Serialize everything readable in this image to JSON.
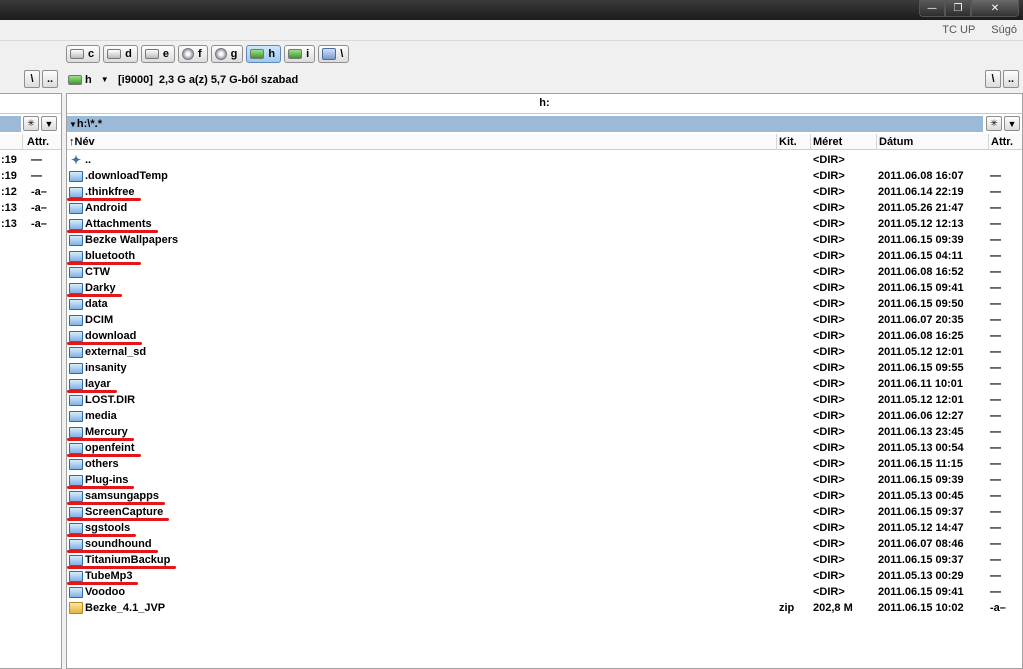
{
  "window": {
    "min_label": "—",
    "restore_label": "❐",
    "close_label": "✕"
  },
  "menu": {
    "right_items": [
      "TC UP",
      "Súgó"
    ]
  },
  "drives": [
    {
      "letter": "c",
      "icon": "hdd-icon"
    },
    {
      "letter": "d",
      "icon": "hdd-icon"
    },
    {
      "letter": "e",
      "icon": "hdd-icon"
    },
    {
      "letter": "f",
      "icon": "cd-icon"
    },
    {
      "letter": "g",
      "icon": "cd-icon"
    },
    {
      "letter": "h",
      "icon": "usb-drive-icon",
      "active": true
    },
    {
      "letter": "i",
      "icon": "usb-drive-icon"
    },
    {
      "letter": "\\",
      "icon": "network-icon"
    }
  ],
  "path_buttons": {
    "root": "\\",
    "up": ".."
  },
  "drive_info": {
    "drive": "h",
    "label": "[i9000]",
    "free": "2,3 G a(z) 5,7 G-ból szabad"
  },
  "left_panel": {
    "header_attr": "Attr.",
    "rows": [
      {
        "time": ":19",
        "attr": "—"
      },
      {
        "time": ":19",
        "attr": "—"
      },
      {
        "time": ":12",
        "attr": "-a–"
      },
      {
        "time": ":13",
        "attr": "-a–"
      },
      {
        "time": ":13",
        "attr": "-a–"
      }
    ]
  },
  "right_panel": {
    "current_dir": "h:",
    "path": "h:\\*.*",
    "columns": {
      "name": "Név",
      "ext": "Kit.",
      "size": "Méret",
      "date": "Dátum",
      "attr": "Attr."
    },
    "sort_indicator": "↑",
    "rows": [
      {
        "name": "..",
        "ext": "",
        "size": "<DIR>",
        "date": "",
        "attr": "",
        "icon": "up-dir-icon",
        "underline": 0
      },
      {
        "name": ".downloadTemp",
        "ext": "",
        "size": "<DIR>",
        "date": "2011.06.08 16:07",
        "attr": "—",
        "icon": "folder-icon",
        "underline": 0
      },
      {
        "name": ".thinkfree",
        "ext": "",
        "size": "<DIR>",
        "date": "2011.06.14 22:19",
        "attr": "—",
        "icon": "folder-icon",
        "underline": 1
      },
      {
        "name": "Android",
        "ext": "",
        "size": "<DIR>",
        "date": "2011.05.26 21:47",
        "attr": "—",
        "icon": "folder-icon",
        "underline": 0
      },
      {
        "name": "Attachments",
        "ext": "",
        "size": "<DIR>",
        "date": "2011.05.12 12:13",
        "attr": "—",
        "icon": "folder-icon",
        "underline": 1
      },
      {
        "name": "Bezke Wallpapers",
        "ext": "",
        "size": "<DIR>",
        "date": "2011.06.15 09:39",
        "attr": "—",
        "icon": "folder-icon",
        "underline": 0
      },
      {
        "name": "bluetooth",
        "ext": "",
        "size": "<DIR>",
        "date": "2011.06.15 04:11",
        "attr": "—",
        "icon": "folder-icon",
        "underline": 1
      },
      {
        "name": "CTW",
        "ext": "",
        "size": "<DIR>",
        "date": "2011.06.08 16:52",
        "attr": "—",
        "icon": "folder-icon",
        "underline": 0
      },
      {
        "name": "Darky",
        "ext": "",
        "size": "<DIR>",
        "date": "2011.06.15 09:41",
        "attr": "—",
        "icon": "folder-icon",
        "underline": 1
      },
      {
        "name": "data",
        "ext": "",
        "size": "<DIR>",
        "date": "2011.06.15 09:50",
        "attr": "—",
        "icon": "folder-icon",
        "underline": 0
      },
      {
        "name": "DCIM",
        "ext": "",
        "size": "<DIR>",
        "date": "2011.06.07 20:35",
        "attr": "—",
        "icon": "folder-icon",
        "underline": 0
      },
      {
        "name": "download",
        "ext": "",
        "size": "<DIR>",
        "date": "2011.06.08 16:25",
        "attr": "—",
        "icon": "folder-icon",
        "underline": 1
      },
      {
        "name": "external_sd",
        "ext": "",
        "size": "<DIR>",
        "date": "2011.05.12 12:01",
        "attr": "—",
        "icon": "folder-icon",
        "underline": 0
      },
      {
        "name": "insanity",
        "ext": "",
        "size": "<DIR>",
        "date": "2011.06.15 09:55",
        "attr": "—",
        "icon": "folder-icon",
        "underline": 0
      },
      {
        "name": "layar",
        "ext": "",
        "size": "<DIR>",
        "date": "2011.06.11 10:01",
        "attr": "—",
        "icon": "folder-icon",
        "underline": 1
      },
      {
        "name": "LOST.DIR",
        "ext": "",
        "size": "<DIR>",
        "date": "2011.05.12 12:01",
        "attr": "—",
        "icon": "folder-icon",
        "underline": 0
      },
      {
        "name": "media",
        "ext": "",
        "size": "<DIR>",
        "date": "2011.06.06 12:27",
        "attr": "—",
        "icon": "folder-icon",
        "underline": 0
      },
      {
        "name": "Mercury",
        "ext": "",
        "size": "<DIR>",
        "date": "2011.06.13 23:45",
        "attr": "—",
        "icon": "folder-icon",
        "underline": 1
      },
      {
        "name": "openfeint",
        "ext": "",
        "size": "<DIR>",
        "date": "2011.05.13 00:54",
        "attr": "—",
        "icon": "folder-icon",
        "underline": 1
      },
      {
        "name": "others",
        "ext": "",
        "size": "<DIR>",
        "date": "2011.06.15 11:15",
        "attr": "—",
        "icon": "folder-icon",
        "underline": 0
      },
      {
        "name": "Plug-ins",
        "ext": "",
        "size": "<DIR>",
        "date": "2011.06.15 09:39",
        "attr": "—",
        "icon": "folder-icon",
        "underline": 1
      },
      {
        "name": "samsungapps",
        "ext": "",
        "size": "<DIR>",
        "date": "2011.05.13 00:45",
        "attr": "—",
        "icon": "folder-icon",
        "underline": 1
      },
      {
        "name": "ScreenCapture",
        "ext": "",
        "size": "<DIR>",
        "date": "2011.06.15 09:37",
        "attr": "—",
        "icon": "folder-icon",
        "underline": 1
      },
      {
        "name": "sgstools",
        "ext": "",
        "size": "<DIR>",
        "date": "2011.05.12 14:47",
        "attr": "—",
        "icon": "folder-icon",
        "underline": 1
      },
      {
        "name": "soundhound",
        "ext": "",
        "size": "<DIR>",
        "date": "2011.06.07 08:46",
        "attr": "—",
        "icon": "folder-icon",
        "underline": 1
      },
      {
        "name": "TitaniumBackup",
        "ext": "",
        "size": "<DIR>",
        "date": "2011.06.15 09:37",
        "attr": "—",
        "icon": "folder-icon",
        "underline": 1
      },
      {
        "name": "TubeMp3",
        "ext": "",
        "size": "<DIR>",
        "date": "2011.05.13 00:29",
        "attr": "—",
        "icon": "folder-icon",
        "underline": 1
      },
      {
        "name": "Voodoo",
        "ext": "",
        "size": "<DIR>",
        "date": "2011.06.15 09:41",
        "attr": "—",
        "icon": "folder-icon",
        "underline": 0
      },
      {
        "name": "Bezke_4.1_JVP",
        "ext": "zip",
        "size": "202,8 M",
        "date": "2011.06.15 10:02",
        "attr": "-a–",
        "icon": "zip-file-icon",
        "underline": 0
      }
    ]
  },
  "colors": {
    "pathline": "#9cbad8",
    "underline": "#e3161a",
    "titlebar": "#2a2a2a"
  }
}
